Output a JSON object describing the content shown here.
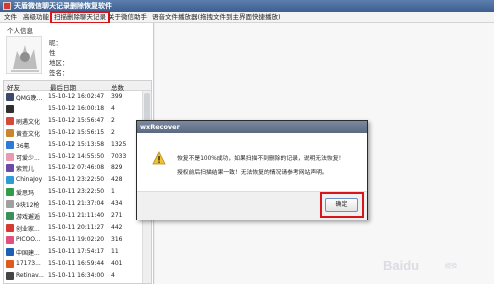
{
  "window": {
    "title": "天盾微信聊天记录删除恢复软件"
  },
  "menu": [
    {
      "label": "文件"
    },
    {
      "label": "高级功能"
    },
    {
      "label": "扫描删除聊天记录"
    },
    {
      "label": "关于微信助手"
    },
    {
      "label": "语音文件播放器(拖拽文件到主界面快捷播放)"
    }
  ],
  "profile": {
    "section_title": "个人信息",
    "fields": [
      "昵：",
      "性",
      "地区：",
      "签名："
    ]
  },
  "list": {
    "headers": [
      "好友",
      "最后日期",
      "总数"
    ],
    "rows": [
      {
        "name": "QMG晚...",
        "date": "15-10-12 16:02:47",
        "count": "399",
        "color": "#3b4a6b"
      },
      {
        "name": "",
        "date": "15-10-12 16:00:18",
        "count": "4",
        "color": "#2f2f2f"
      },
      {
        "name": "刷遇文化",
        "date": "15-10-12 15:56:47",
        "count": "2",
        "color": "#d34a3a"
      },
      {
        "name": "黄查文化",
        "date": "15-10-12 15:56:15",
        "count": "2",
        "color": "#c9862f"
      },
      {
        "name": "36氪",
        "date": "15-10-12 15:13:58",
        "count": "1325",
        "color": "#2c7ad6"
      },
      {
        "name": "可爱少...",
        "date": "15-10-12 14:55:50",
        "count": "7033",
        "color": "#e79ab1"
      },
      {
        "name": "紫荒儿",
        "date": "15-10-12 07:46:08",
        "count": "829",
        "color": "#6b4aa8"
      },
      {
        "name": "ChinaJoy",
        "date": "15-10-11 23:22:50",
        "count": "428",
        "color": "#2d9bd8"
      },
      {
        "name": "爱思玛",
        "date": "15-10-11 23:22:50",
        "count": "1",
        "color": "#2f9e4b"
      },
      {
        "name": "9块12枪",
        "date": "15-10-11 21:37:04",
        "count": "434",
        "color": "#a0a0a0"
      },
      {
        "name": "游戏邂逅",
        "date": "15-10-11 21:11:40",
        "count": "271",
        "color": "#3a8f5a"
      },
      {
        "name": "创业家...",
        "date": "15-10-11 20:11:27",
        "count": "442",
        "color": "#d6392e"
      },
      {
        "name": "PICOO...",
        "date": "15-10-11 19:02:20",
        "count": "316",
        "color": "#e0507e"
      },
      {
        "name": "中国建...",
        "date": "15-10-11 17:54:17",
        "count": "11",
        "color": "#1c5fb3"
      },
      {
        "name": "17173...",
        "date": "15-10-11 16:59:44",
        "count": "401",
        "color": "#e05a1b"
      },
      {
        "name": "Retinav...",
        "date": "15-10-11 16:34:00",
        "count": "4",
        "color": "#444444"
      }
    ]
  },
  "dialog": {
    "title": "wxRecover",
    "message_line1": "恢复不是100%成功，如果扫描不到删除的记录，说明无法恢复！",
    "message_line2": "授权前后扫描结果一致！无法恢复的情况请参考网站声明。",
    "ok_label": "确定"
  },
  "watermark": {
    "text": "Baidu",
    "sub": "经验"
  },
  "colors": {
    "highlight_border": "#d9151c",
    "titlebar": "#3d5f8f"
  }
}
